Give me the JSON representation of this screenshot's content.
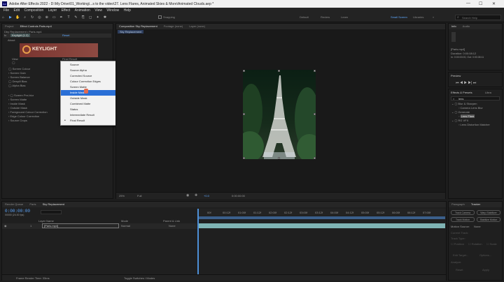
{
  "window": {
    "title": "Adobe After Effects 2022 - D:\\My Drive\\01_Working\\...s to the video\\27. Lens Flares, Animated Skies & More\\Animated Clouds.aep *",
    "min": "—",
    "max": "☐",
    "close": "✕"
  },
  "menu": [
    "File",
    "Edit",
    "Composition",
    "Layer",
    "Effect",
    "Animation",
    "View",
    "Window",
    "Help"
  ],
  "toolbar": {
    "snapping": "Snapping",
    "workspaces": [
      "Default",
      "Review",
      "Learn",
      "Standard",
      "Libraries",
      "Animation",
      "Essential Graphics",
      "Small Screen",
      "Effects"
    ],
    "active_workspace": "Small Screen",
    "search": "Search Help"
  },
  "left_panel": {
    "tabs": [
      "Project",
      "Effect Controls Paris.mp4"
    ],
    "header": "Dby Replacement • Paris.mp4",
    "effect_name": "Keylight (1.2)",
    "reset": "Reset",
    "about": "About",
    "logo_text": "KEYLIGHT",
    "view_label": "View",
    "view_value": "Final Result",
    "params": [
      "Unpremultiply Result",
      "Screen Colour",
      "Screen Gain",
      "Screen Balance",
      "Despill Bias",
      "Alpha Bias",
      "Lock Biases Together",
      "Screen Pre-blur",
      "Screen Matte",
      "Inside Mask",
      "Outside Mask",
      "Foreground Colour Correction",
      "Edge Colour Correction",
      "Source Crops"
    ]
  },
  "dropdown": {
    "items": [
      "Source",
      "Source Alpha",
      "Corrected Source",
      "Colour Correction Edges",
      "Screen Matte",
      "Inside Mask",
      "Outside Mask",
      "Combined Matte",
      "Status",
      "Intermediate Result",
      "Final Result"
    ],
    "selected": "Inside Mask",
    "checked": "Final Result"
  },
  "viewer": {
    "tabs": [
      "Composition Sky Replacement",
      "Footage (none)",
      "Layer (none)"
    ],
    "comp_label": "Sky Replacement",
    "zoom": "25%",
    "quality": "Full",
    "timecode": "0:00:00:00",
    "exposure": "+0.0"
  },
  "info_panel": {
    "tabs": [
      "Info",
      "Audio"
    ],
    "lines": [
      "[Paris.mp4]",
      "Duration: 0:00:08:12",
      "In: 0:00:00:00, Out: 0:00:08:11"
    ]
  },
  "preview_panel": {
    "title": "Preview"
  },
  "effects_panel": {
    "title": "Effects & Presets",
    "libs": "Libra",
    "search": "lens",
    "tree": [
      "Blur & Sharpen",
      "Camera Lens Blur",
      "Generate",
      "Lens Flare",
      "RG VFX",
      "Lens Distortion Matcher"
    ],
    "selected": "Lens Flare"
  },
  "tracker_panel": {
    "tabs": [
      "Paragraph",
      "Tracker"
    ],
    "buttons": [
      "Track Camera",
      "Warp Stabilizer",
      "Track Motion",
      "Stabilize Motion"
    ],
    "motion_source_label": "Motion Source:",
    "motion_source": "None",
    "current_track_label": "Current Track:",
    "track_type_label": "Track Type:",
    "checks": [
      "Position",
      "Rotation",
      "Scale"
    ],
    "bottom": [
      "Edit Target...",
      "Options...",
      "Analyze:",
      "Reset",
      "Apply"
    ]
  },
  "timeline": {
    "tabs": [
      "Render Queue",
      "Paris",
      "Sky Replacement"
    ],
    "timecode": "0:00:00:00",
    "frame_info": "00000 (24.00 fps)",
    "columns": [
      "#",
      "Layer Name",
      "Mode",
      "T",
      "TrkMat",
      "Parent & Link"
    ],
    "layer": {
      "num": "1",
      "name": "[Paris.mp4]",
      "mode": "Normal",
      "parent": "None"
    },
    "ruler": [
      "00f",
      "00:12f",
      "01:00f",
      "01:12f",
      "02:00f",
      "02:12f",
      "03:00f",
      "03:12f",
      "04:00f",
      "04:12f",
      "05:00f",
      "05:12f",
      "06:00f",
      "06:12f",
      "07:00f",
      "07:12f",
      "08:00f"
    ],
    "footer_left": "Frame Render Time: 33ms",
    "footer_mid": "Toggle Switches / Modes"
  }
}
